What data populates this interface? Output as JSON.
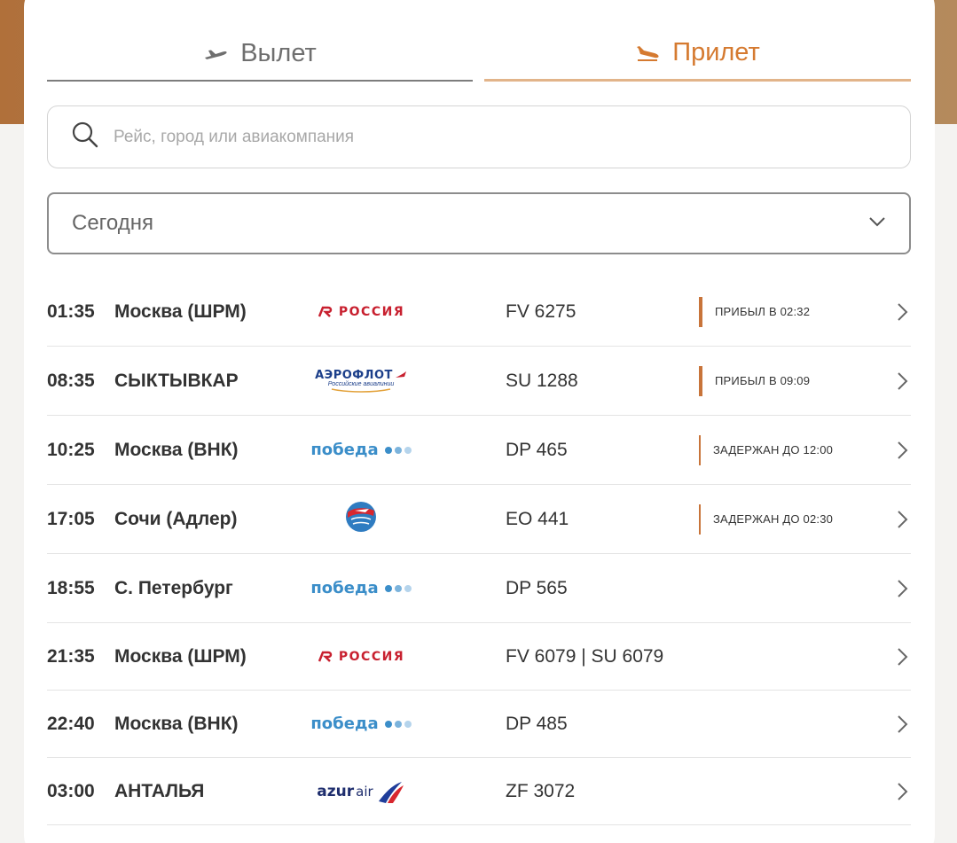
{
  "tabs": [
    {
      "label": "Вылет",
      "icon": "departure-plane-icon",
      "active": false
    },
    {
      "label": "Прилет",
      "icon": "arrival-plane-icon",
      "active": true
    }
  ],
  "search": {
    "placeholder": "Рейс, город или авиакомпания",
    "value": ""
  },
  "date_select": {
    "value": "Сегодня"
  },
  "colors": {
    "accent": "#d57a30",
    "status_bar": "#c8743a",
    "text": "#333333"
  },
  "flights": [
    {
      "time": "01:35",
      "city": "Москва (ШРМ)",
      "airline_logo": "rossiya-logo",
      "airline_text": "РОССИЯ",
      "flight": "FV 6275",
      "status": "ПРИБЫЛ В 02:32",
      "status_type": "arrived"
    },
    {
      "time": "08:35",
      "city": "СЫКТЫВКАР",
      "airline_logo": "aeroflot-logo",
      "airline_text": "АЭРОФЛОТ",
      "airline_subtext": "Российские авиалинии",
      "flight": "SU 1288",
      "status": "ПРИБЫЛ В 09:09",
      "status_type": "arrived"
    },
    {
      "time": "10:25",
      "city": "Москва (ВНК)",
      "airline_logo": "pobeda-logo",
      "airline_text": "победа",
      "flight": "DP 465",
      "status": "ЗАДЕРЖАН ДО 12:00",
      "status_type": "delayed"
    },
    {
      "time": "17:05",
      "city": "Сочи (Адлер)",
      "airline_logo": "ikar-logo",
      "flight": "EO 441",
      "status": "ЗАДЕРЖАН ДО 02:30",
      "status_type": "delayed"
    },
    {
      "time": "18:55",
      "city": "С. Петербург",
      "airline_logo": "pobeda-logo",
      "airline_text": "победа",
      "flight": "DP 565",
      "status": "",
      "status_type": "none"
    },
    {
      "time": "21:35",
      "city": "Москва (ШРМ)",
      "airline_logo": "rossiya-logo",
      "airline_text": "РОССИЯ",
      "flight": "FV 6079 | SU 6079",
      "status": "",
      "status_type": "none"
    },
    {
      "time": "22:40",
      "city": "Москва (ВНК)",
      "airline_logo": "pobeda-logo",
      "airline_text": "победа",
      "flight": "DP 485",
      "status": "",
      "status_type": "none"
    },
    {
      "time": "03:00",
      "city": "АНТАЛЬЯ",
      "airline_logo": "azurair-logo",
      "airline_text": "azur",
      "airline_text2": "air",
      "flight": "ZF 3072",
      "status": "",
      "status_type": "none"
    }
  ]
}
